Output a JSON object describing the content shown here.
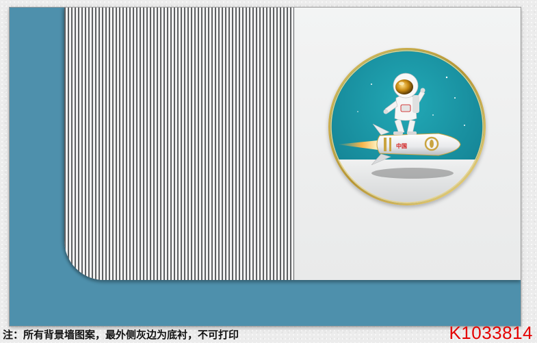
{
  "footer": {
    "note": "注：所有背景墙图案，最外侧灰边为底衬，不可打印",
    "code": "K1033814"
  },
  "artwork": {
    "icon": "astronaut-riding-rocket",
    "rocket_badge": "中国",
    "colors": {
      "teal_frame": "#4e90ac",
      "stripe_dark": "#5d5f61",
      "panel": "#eceded",
      "medallion_sky": "#1a97a6",
      "gold": "#c9a441",
      "code_red": "#e40000"
    }
  }
}
